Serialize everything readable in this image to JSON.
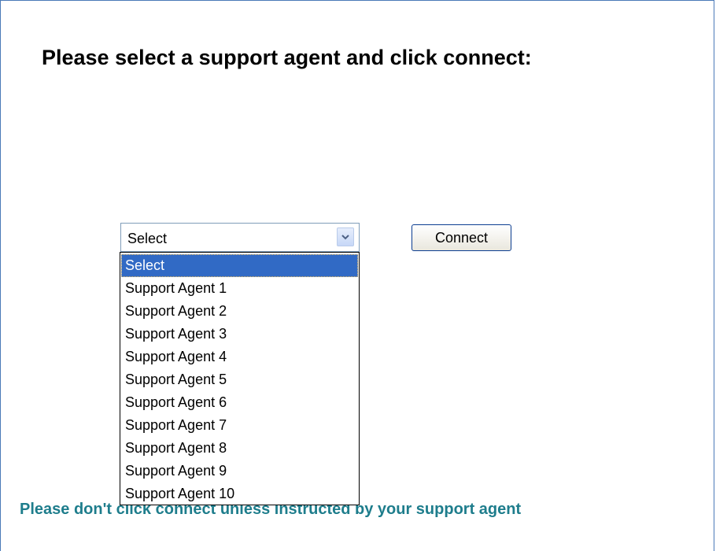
{
  "page": {
    "title": "Please select a support agent and click connect:",
    "footer_note": "Please don't  click connect unless instructed by  your support agent"
  },
  "agent_select": {
    "value": "Select",
    "options": [
      "Select",
      "Support Agent 1",
      "Support Agent 2",
      "Support Agent 3",
      "Support Agent 4",
      "Support Agent 5",
      "Support Agent 6",
      "Support Agent 7",
      "Support Agent 8",
      "Support Agent 9",
      "Support Agent 10"
    ],
    "highlighted_index": 0
  },
  "connect_button": {
    "label": "Connect"
  },
  "colors": {
    "frame_border": "#4a7ab8",
    "highlight": "#316ac5",
    "footer_text": "#1e7d8c"
  },
  "icons": {
    "dropdown_arrow": "chevron-down-icon"
  }
}
